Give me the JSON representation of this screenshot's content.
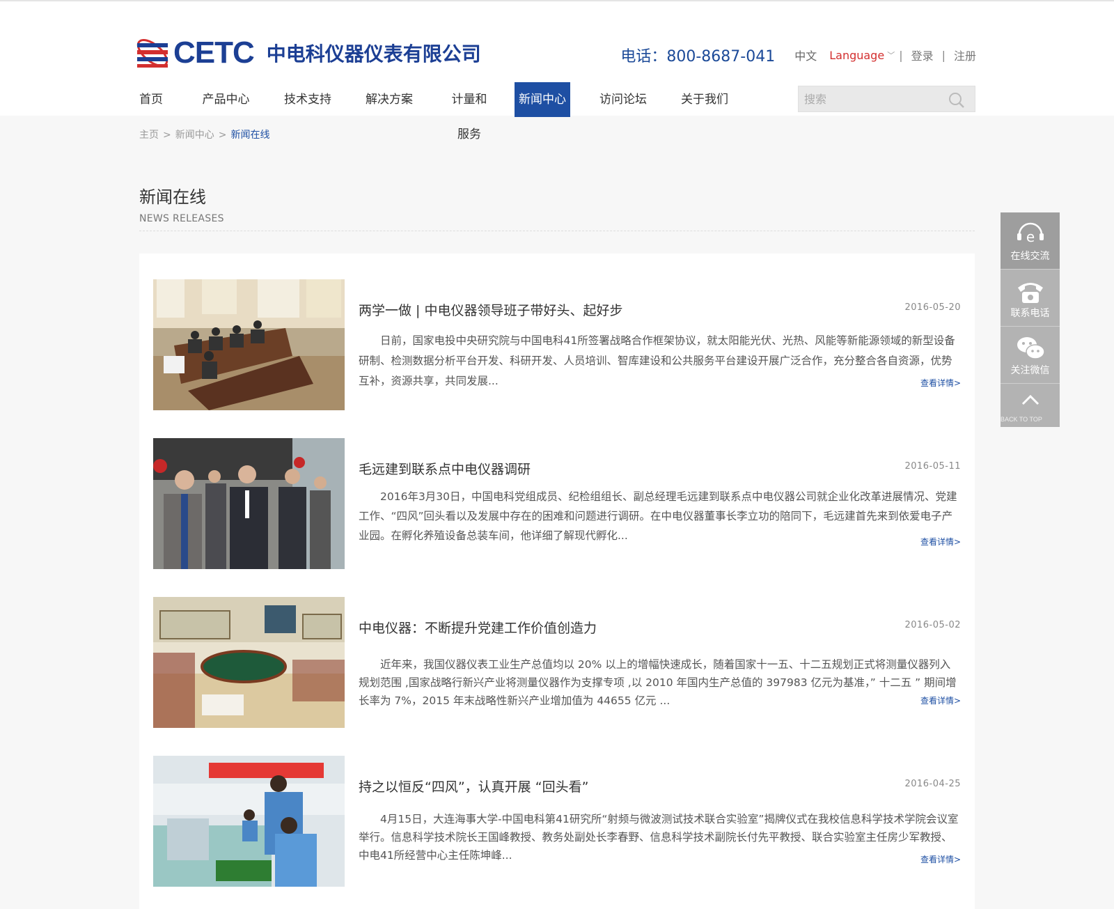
{
  "brand": {
    "logo_text": "CETC",
    "company_name": "中电科仪器仪表有限公司",
    "accent": "#1e4fa3",
    "logo_red": "#d32f2f"
  },
  "topbar": {
    "phone": "电话：800-8687-041",
    "lang_cn": "中文",
    "language": "Language",
    "sep": "|",
    "login": "登录",
    "register": "注册"
  },
  "nav": {
    "items": [
      {
        "label": "首页"
      },
      {
        "label": "产品中心"
      },
      {
        "label": "技术支持"
      },
      {
        "label": "解决方案"
      },
      {
        "label": "计量和服务"
      },
      {
        "label": "新闻中心"
      },
      {
        "label": "访问论坛"
      },
      {
        "label": "关于我们"
      }
    ],
    "active": "新闻中心"
  },
  "search": {
    "placeholder": "搜索"
  },
  "breadcrumb": {
    "home": "主页",
    "section": "新闻中心",
    "current": "新闻在线",
    "gt": ">"
  },
  "section": {
    "title": "新闻在线",
    "subtitle": "NEWS RELEASES"
  },
  "news": [
    {
      "title": "两学一做 | 中电仪器领导班子带好头、起好步",
      "date": "2016-05-20",
      "summary": "日前，国家电投中央研究院与中国电科41所签署战略合作框架协议，就太阳能光伏、光热、风能等新能源领域的新型设备研制、检测数据分析平台开发、科研开发、人员培训、智库建设和公共服务平台建设开展广泛合作，充分整合各自资源，优势互补，资源共享，共同发展...",
      "more": "查看详情>"
    },
    {
      "title": "毛远建到联系点中电仪器调研",
      "date": "2016-05-11",
      "summary": "2016年3月30日，中国电科党组成员、纪检组组长、副总经理毛远建到联系点中电仪器公司就企业化改革进展情况、党建工作、“四风”回头看以及发展中存在的困难和问题进行调研。在中电仪器董事长李立功的陪同下，毛远建首先来到依爱电子产业园。在孵化养殖设备总装车间，他详细了解现代孵化...",
      "more": "查看详情>"
    },
    {
      "title": "中电仪器：不断提升党建工作价值创造力",
      "date": "2016-05-02",
      "summary": "近年来，我国仪器仪表工业生产总值均以 20% 以上的增幅快速成长，随着国家十一五、十二五规划正式将测量仪器列入规划范围 ,国家战略行新兴产业将测量仪器作为支撑专项 ,以 2010 年国内生产总值的 397983 亿元为基准，” 十二五 ” 期间增长率为 7%，2015 年末战略性新兴产业增加值为 44655 亿元 ...",
      "more": "查看详情>"
    },
    {
      "title": "持之以恒反“四风”，认真开展 “回头看”",
      "date": "2016-04-25",
      "summary": "4月15日，大连海事大学-中国电科第41研究所“射频与微波测试技术联合实验室”揭牌仪式在我校信息科学技术学院会议室举行。信息科学技术院长王国峰教授、教务处副处长李春野、信息科学技术副院长付先平教授、联合实验室主任房少军教授、中电41所经营中心主任陈坤峰...",
      "more": "查看详情>"
    }
  ],
  "sidebar": {
    "chat": "在线交流",
    "phone": "联系电话",
    "wechat": "关注微信",
    "top": "BACK TO TOP"
  }
}
